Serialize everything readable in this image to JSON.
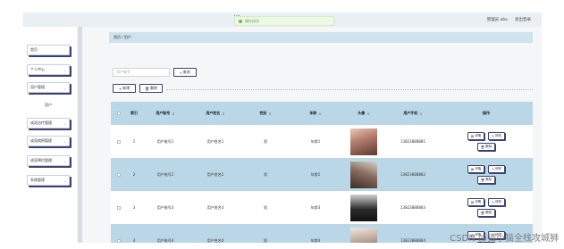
{
  "header": {
    "title": "…",
    "toast": "操作成功",
    "user_label": "管理员 abo",
    "logout": "退出登录"
  },
  "sidebar": {
    "items": [
      {
        "label": "首页",
        "arrow": ""
      },
      {
        "label": "个人中心",
        "arrow": "⌄"
      },
      {
        "label": "用户管理",
        "arrow": "⌄"
      },
      {
        "label": "用户",
        "arrow": ""
      },
      {
        "label": "成双治疗管理",
        "arrow": "⌄"
      },
      {
        "label": "成双病例管理",
        "arrow": "⌄"
      },
      {
        "label": "成双预约管理",
        "arrow": "⌄"
      },
      {
        "label": "系统管理",
        "arrow": "⌄"
      }
    ]
  },
  "breadcrumb": "首页 / 用户",
  "search": {
    "placeholder": "用户账号",
    "button": "查询"
  },
  "toolbar": {
    "add": "新增",
    "delete": "删除"
  },
  "table": {
    "headers": [
      "",
      "索引",
      "用户账号",
      "用户姓名",
      "性别",
      "年龄",
      "头像",
      "用户手机",
      "操作"
    ],
    "sort_indicator": "⇕",
    "rows": [
      {
        "index": "1",
        "account": "用户账号1",
        "name": "用户姓名1",
        "gender": "男",
        "age": "年龄1",
        "phone": "13823888881"
      },
      {
        "index": "2",
        "account": "用户账号2",
        "name": "用户姓名2",
        "gender": "男",
        "age": "年龄2",
        "phone": "13823888882"
      },
      {
        "index": "3",
        "account": "用户账号3",
        "name": "用户姓名3",
        "gender": "男",
        "age": "年龄3",
        "phone": "13823888883"
      },
      {
        "index": "4",
        "account": "用户账号4",
        "name": "用户姓名4",
        "gender": "男",
        "age": "年龄4",
        "phone": "13823888884"
      }
    ],
    "actions": {
      "detail": "详情",
      "edit": "修改",
      "delete": "删除"
    }
  },
  "watermark": "CSDN @猫小猫全栈攻城狮",
  "colors": {
    "header_bg": "#bad7e8",
    "row_alt_bg": "#bad7e8",
    "accent": "#3b4470",
    "toast": "#67c23a"
  }
}
